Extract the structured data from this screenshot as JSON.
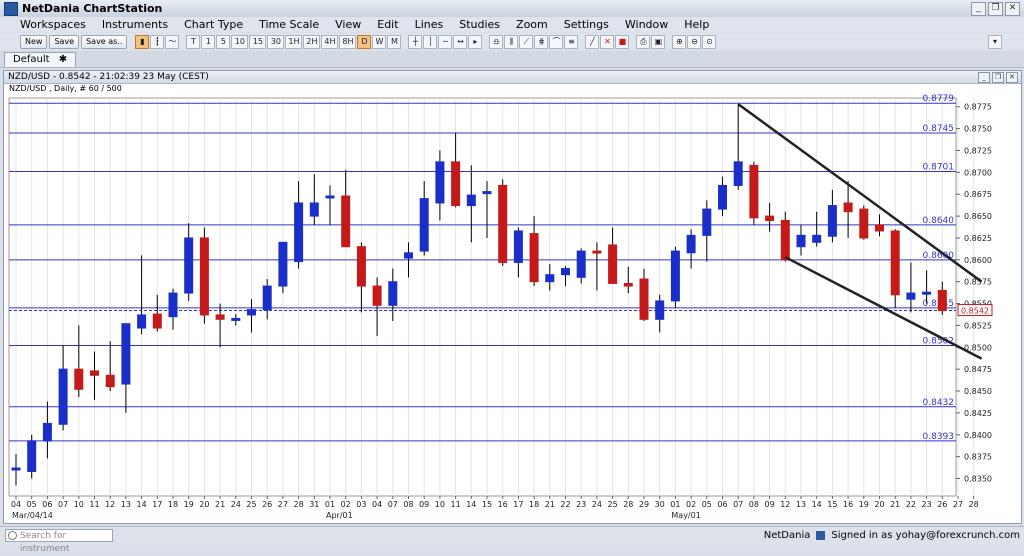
{
  "app": {
    "title": "NetDania ChartStation"
  },
  "menu": [
    "Workspaces",
    "Instruments",
    "Chart Type",
    "Time Scale",
    "View",
    "Edit",
    "Lines",
    "Studies",
    "Zoom",
    "Settings",
    "Window",
    "Help"
  ],
  "toolbar": {
    "new_label": "New",
    "save_label": "Save",
    "saveas_label": "Save as..",
    "time_buttons": [
      "T",
      "1",
      "5",
      "10",
      "15",
      "30",
      "1H",
      "2H",
      "4H",
      "8H",
      "D",
      "W",
      "M"
    ],
    "selected_time": "D"
  },
  "tabs": [
    {
      "label": "Default",
      "close": "✱"
    }
  ],
  "chart_window": {
    "title": "NZD/USD - 0.8542 - 21:02:39  23 May (CEST)",
    "subtitle": "NZD/USD , Daily, # 60 / 500"
  },
  "status": {
    "search_placeholder": "Search for instrument",
    "brand": "NetDania",
    "signed_in": "Signed in as yohay@forexcrunch.com"
  },
  "colors": {
    "up": "#1a2fc9",
    "down": "#c41a1a",
    "hline": "#3333cc",
    "trend": "#222222"
  },
  "chart_data": {
    "type": "candlestick",
    "instrument": "NZD/USD",
    "ylim": [
      0.833,
      0.8785
    ],
    "y_ticks": [
      0.835,
      0.8375,
      0.84,
      0.8425,
      0.845,
      0.8475,
      0.85,
      0.8525,
      0.855,
      0.8575,
      0.86,
      0.8625,
      0.865,
      0.8675,
      0.87,
      0.8725,
      0.875,
      0.8775
    ],
    "x_labels": [
      "04",
      "05",
      "06",
      "07",
      "10",
      "11",
      "12",
      "13",
      "14",
      "17",
      "18",
      "19",
      "20",
      "21",
      "24",
      "25",
      "26",
      "27",
      "28",
      "31",
      "01",
      "02",
      "03",
      "04",
      "07",
      "08",
      "09",
      "10",
      "11",
      "14",
      "15",
      "16",
      "17",
      "18",
      "21",
      "22",
      "23",
      "24",
      "25",
      "28",
      "29",
      "30",
      "01",
      "02",
      "05",
      "06",
      "07",
      "08",
      "09",
      "12",
      "13",
      "14",
      "15",
      "16",
      "19",
      "20",
      "21",
      "22",
      "23",
      "26",
      "27",
      "28"
    ],
    "month_labels": [
      {
        "label": "Mar/04/14",
        "index": 0
      },
      {
        "label": "Apr/01",
        "index": 20
      },
      {
        "label": "May/01",
        "index": 42
      }
    ],
    "candles": [
      {
        "o": 0.8362,
        "h": 0.8378,
        "l": 0.8342,
        "c": 0.8362
      },
      {
        "o": 0.8358,
        "h": 0.84,
        "l": 0.835,
        "c": 0.8393
      },
      {
        "o": 0.8393,
        "h": 0.8438,
        "l": 0.8373,
        "c": 0.8413
      },
      {
        "o": 0.8412,
        "h": 0.8502,
        "l": 0.8405,
        "c": 0.8475
      },
      {
        "o": 0.8475,
        "h": 0.8525,
        "l": 0.8443,
        "c": 0.8452
      },
      {
        "o": 0.8473,
        "h": 0.8495,
        "l": 0.844,
        "c": 0.8468
      },
      {
        "o": 0.8468,
        "h": 0.8507,
        "l": 0.845,
        "c": 0.8455
      },
      {
        "o": 0.8458,
        "h": 0.8527,
        "l": 0.8425,
        "c": 0.8527
      },
      {
        "o": 0.8522,
        "h": 0.8605,
        "l": 0.8515,
        "c": 0.8537
      },
      {
        "o": 0.8538,
        "h": 0.856,
        "l": 0.8518,
        "c": 0.8522
      },
      {
        "o": 0.8535,
        "h": 0.8567,
        "l": 0.852,
        "c": 0.8562
      },
      {
        "o": 0.8562,
        "h": 0.8642,
        "l": 0.8553,
        "c": 0.8625
      },
      {
        "o": 0.8625,
        "h": 0.8637,
        "l": 0.8527,
        "c": 0.8537
      },
      {
        "o": 0.8537,
        "h": 0.855,
        "l": 0.85,
        "c": 0.8532
      },
      {
        "o": 0.8532,
        "h": 0.8538,
        "l": 0.8525,
        "c": 0.8533
      },
      {
        "o": 0.8537,
        "h": 0.8555,
        "l": 0.8517,
        "c": 0.8543
      },
      {
        "o": 0.8543,
        "h": 0.8578,
        "l": 0.8532,
        "c": 0.857
      },
      {
        "o": 0.857,
        "h": 0.862,
        "l": 0.8562,
        "c": 0.862
      },
      {
        "o": 0.8598,
        "h": 0.869,
        "l": 0.859,
        "c": 0.8665
      },
      {
        "o": 0.865,
        "h": 0.8698,
        "l": 0.864,
        "c": 0.8665
      },
      {
        "o": 0.8673,
        "h": 0.8685,
        "l": 0.864,
        "c": 0.8673
      },
      {
        "o": 0.8673,
        "h": 0.8703,
        "l": 0.8623,
        "c": 0.8615
      },
      {
        "o": 0.8615,
        "h": 0.862,
        "l": 0.854,
        "c": 0.857
      },
      {
        "o": 0.857,
        "h": 0.858,
        "l": 0.8513,
        "c": 0.8548
      },
      {
        "o": 0.8548,
        "h": 0.859,
        "l": 0.853,
        "c": 0.8575
      },
      {
        "o": 0.8602,
        "h": 0.862,
        "l": 0.858,
        "c": 0.8608
      },
      {
        "o": 0.861,
        "h": 0.869,
        "l": 0.8605,
        "c": 0.867
      },
      {
        "o": 0.8665,
        "h": 0.8725,
        "l": 0.8645,
        "c": 0.8712
      },
      {
        "o": 0.8712,
        "h": 0.8745,
        "l": 0.866,
        "c": 0.8662
      },
      {
        "o": 0.8662,
        "h": 0.8708,
        "l": 0.862,
        "c": 0.8674
      },
      {
        "o": 0.8678,
        "h": 0.869,
        "l": 0.8625,
        "c": 0.8678
      },
      {
        "o": 0.8685,
        "h": 0.8692,
        "l": 0.8593,
        "c": 0.8597
      },
      {
        "o": 0.8597,
        "h": 0.8637,
        "l": 0.858,
        "c": 0.8633
      },
      {
        "o": 0.863,
        "h": 0.865,
        "l": 0.857,
        "c": 0.8575
      },
      {
        "o": 0.8575,
        "h": 0.8595,
        "l": 0.8565,
        "c": 0.8583
      },
      {
        "o": 0.8583,
        "h": 0.8593,
        "l": 0.857,
        "c": 0.859
      },
      {
        "o": 0.858,
        "h": 0.8613,
        "l": 0.8573,
        "c": 0.861
      },
      {
        "o": 0.861,
        "h": 0.862,
        "l": 0.8565,
        "c": 0.8608
      },
      {
        "o": 0.8617,
        "h": 0.8637,
        "l": 0.8578,
        "c": 0.8573
      },
      {
        "o": 0.8573,
        "h": 0.8592,
        "l": 0.8562,
        "c": 0.857
      },
      {
        "o": 0.8578,
        "h": 0.859,
        "l": 0.853,
        "c": 0.8532
      },
      {
        "o": 0.8532,
        "h": 0.856,
        "l": 0.8517,
        "c": 0.8553
      },
      {
        "o": 0.8553,
        "h": 0.8615,
        "l": 0.8545,
        "c": 0.861
      },
      {
        "o": 0.8608,
        "h": 0.8635,
        "l": 0.859,
        "c": 0.8628
      },
      {
        "o": 0.8628,
        "h": 0.8668,
        "l": 0.8598,
        "c": 0.8658
      },
      {
        "o": 0.8658,
        "h": 0.8695,
        "l": 0.865,
        "c": 0.8685
      },
      {
        "o": 0.8685,
        "h": 0.8778,
        "l": 0.868,
        "c": 0.8712
      },
      {
        "o": 0.8708,
        "h": 0.8712,
        "l": 0.864,
        "c": 0.8648
      },
      {
        "o": 0.865,
        "h": 0.8665,
        "l": 0.8632,
        "c": 0.8645
      },
      {
        "o": 0.8645,
        "h": 0.8655,
        "l": 0.8598,
        "c": 0.86
      },
      {
        "o": 0.8615,
        "h": 0.864,
        "l": 0.8605,
        "c": 0.8628
      },
      {
        "o": 0.862,
        "h": 0.8655,
        "l": 0.8615,
        "c": 0.8628
      },
      {
        "o": 0.8627,
        "h": 0.868,
        "l": 0.862,
        "c": 0.8662
      },
      {
        "o": 0.8665,
        "h": 0.869,
        "l": 0.8625,
        "c": 0.8655
      },
      {
        "o": 0.8658,
        "h": 0.8662,
        "l": 0.8623,
        "c": 0.8625
      },
      {
        "o": 0.864,
        "h": 0.8652,
        "l": 0.8627,
        "c": 0.8633
      },
      {
        "o": 0.8633,
        "h": 0.8635,
        "l": 0.8545,
        "c": 0.856
      },
      {
        "o": 0.8555,
        "h": 0.8597,
        "l": 0.854,
        "c": 0.8562
      },
      {
        "o": 0.8562,
        "h": 0.8588,
        "l": 0.855,
        "c": 0.8563
      },
      {
        "o": 0.8565,
        "h": 0.8575,
        "l": 0.8537,
        "c": 0.8542
      }
    ],
    "horizontal_lines": [
      {
        "value": 0.8779,
        "label": "0.8779"
      },
      {
        "value": 0.8745,
        "label": "0.8745"
      },
      {
        "value": 0.8701,
        "label": "0.8701"
      },
      {
        "value": 0.864,
        "label": "0.8640"
      },
      {
        "value": 0.86,
        "label": "0.8600"
      },
      {
        "value": 0.8545,
        "label": "0.8545"
      },
      {
        "value": 0.8502,
        "label": "0.8502"
      },
      {
        "value": 0.8432,
        "label": "0.8432"
      },
      {
        "value": 0.8393,
        "label": "0.8393"
      }
    ],
    "current_price": {
      "value": 0.8542,
      "label": "0.8542"
    },
    "trendlines": [
      {
        "from": {
          "index": 46,
          "value": 0.8778
        },
        "to": {
          "index": 61.5,
          "value": 0.8575
        }
      },
      {
        "from": {
          "index": 49,
          "value": 0.8603
        },
        "to": {
          "index": 61.5,
          "value": 0.8487
        }
      }
    ]
  }
}
